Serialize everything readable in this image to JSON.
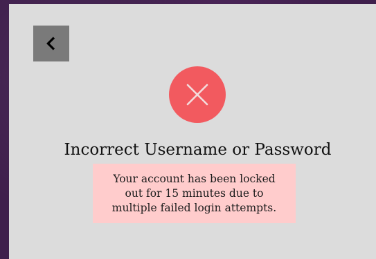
{
  "colors": {
    "page_background": "#3f1f4c",
    "panel_background": "#dcdcdc",
    "back_button_background": "#7a7a7a",
    "error_accent": "#f25a5f",
    "message_background": "#ffcccc"
  },
  "icons": {
    "back": "chevron-left-icon",
    "error": "close-icon"
  },
  "dialog": {
    "title": "Incorrect Username or Password",
    "message_lines": [
      "Your account has been locked",
      "out for 15 minutes due to",
      "multiple failed login attempts."
    ]
  }
}
